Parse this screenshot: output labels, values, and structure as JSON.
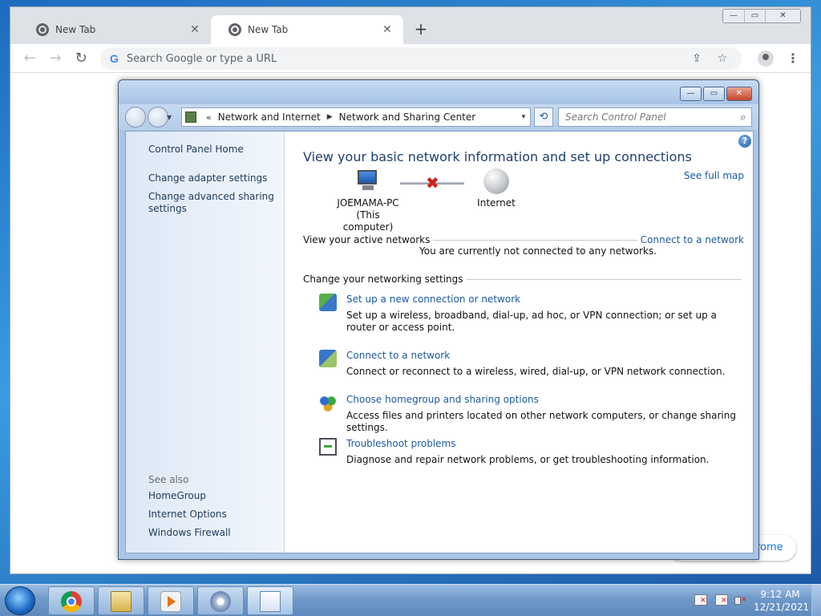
{
  "chrome": {
    "tabs": [
      {
        "title": "New Tab",
        "close": "✕"
      },
      {
        "title": "New Tab",
        "close": "✕"
      }
    ],
    "new_tab": "+",
    "back": "←",
    "forward": "→",
    "reload": "↻",
    "omnibox_g": "G",
    "omnibox_placeholder": "Search Google or type a URL",
    "share_icon": "⇪",
    "bookmark_icon": "☆",
    "menu": "⋮",
    "minimize": "—",
    "restore": "▭",
    "close": "✕",
    "customize_partial": "rome"
  },
  "control_panel": {
    "titlebar": {
      "minimize": "—",
      "maximize": "▭",
      "close": "✕"
    },
    "address": {
      "prefix": "«",
      "crumbs": [
        "Network and Internet",
        "Network and Sharing Center"
      ],
      "separator": "▶",
      "dropdown": "▾",
      "refresh": "⟲"
    },
    "search_placeholder": "Search Control Panel",
    "search_icon": "⌕",
    "sidebar": {
      "home": "Control Panel Home",
      "links": [
        "Change adapter settings",
        "Change advanced sharing settings"
      ],
      "see_also_label": "See also",
      "see_also": [
        "HomeGroup",
        "Internet Options",
        "Windows Firewall"
      ]
    },
    "main": {
      "help": "?",
      "heading": "View your basic network information and set up connections",
      "see_full_map": "See full map",
      "computer_name": "JOEMAMA-PC",
      "computer_sub": "(This computer)",
      "disconnect_mark": "✖",
      "internet_label": "Internet",
      "active_networks_label": "View your active networks",
      "connect_link": "Connect to a network",
      "not_connected": "You are currently not connected to any networks.",
      "change_settings_label": "Change your networking settings",
      "tasks": [
        {
          "link": "Set up a new connection or network",
          "desc": "Set up a wireless, broadband, dial-up, ad hoc, or VPN connection; or set up a router or access point."
        },
        {
          "link": "Connect to a network",
          "desc": "Connect or reconnect to a wireless, wired, dial-up, or VPN network connection."
        },
        {
          "link": "Choose homegroup and sharing options",
          "desc": "Access files and printers located on other network computers, or change sharing settings."
        },
        {
          "link": "Troubleshoot problems",
          "desc": "Diagnose and repair network problems, or get troubleshooting information."
        }
      ]
    }
  },
  "taskbar": {
    "time": "9:12 AM",
    "date": "12/21/2021"
  }
}
